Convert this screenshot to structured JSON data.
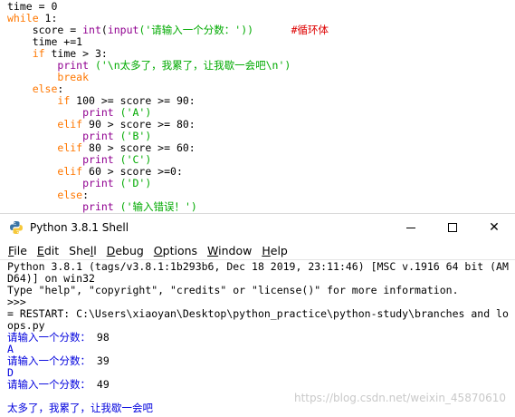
{
  "editor": {
    "lines": [
      [
        {
          "t": "time = 0",
          "c": "df"
        }
      ],
      [
        {
          "t": "while",
          "c": "kw"
        },
        {
          "t": " 1:",
          "c": "df"
        }
      ],
      [
        {
          "t": "    score = ",
          "c": "df"
        },
        {
          "t": "int",
          "c": "bi"
        },
        {
          "t": "(",
          "c": "df"
        },
        {
          "t": "input",
          "c": "bi"
        },
        {
          "t": "('请输入一个分数：'))",
          "c": "st"
        },
        {
          "t": "      ",
          "c": "df"
        },
        {
          "t": "#循环体",
          "c": "cm"
        }
      ],
      [
        {
          "t": "    time +=1",
          "c": "df"
        }
      ],
      [
        {
          "t": "    ",
          "c": "df"
        },
        {
          "t": "if",
          "c": "kw"
        },
        {
          "t": " time > 3:",
          "c": "df"
        }
      ],
      [
        {
          "t": "        ",
          "c": "df"
        },
        {
          "t": "print",
          "c": "bi"
        },
        {
          "t": " ('\\n太多了，我累了，让我歇一会吧\\n')",
          "c": "st"
        }
      ],
      [
        {
          "t": "        ",
          "c": "df"
        },
        {
          "t": "break",
          "c": "kw"
        }
      ],
      [
        {
          "t": "    ",
          "c": "df"
        },
        {
          "t": "else",
          "c": "kw"
        },
        {
          "t": ":",
          "c": "df"
        }
      ],
      [
        {
          "t": "        ",
          "c": "df"
        },
        {
          "t": "if",
          "c": "kw"
        },
        {
          "t": " 100 >= score >= 90:",
          "c": "df"
        }
      ],
      [
        {
          "t": "            ",
          "c": "df"
        },
        {
          "t": "print",
          "c": "bi"
        },
        {
          "t": " ('A')",
          "c": "st"
        }
      ],
      [
        {
          "t": "        ",
          "c": "df"
        },
        {
          "t": "elif",
          "c": "kw"
        },
        {
          "t": " 90 > score >= 80:",
          "c": "df"
        }
      ],
      [
        {
          "t": "            ",
          "c": "df"
        },
        {
          "t": "print",
          "c": "bi"
        },
        {
          "t": " ('B')",
          "c": "st"
        }
      ],
      [
        {
          "t": "        ",
          "c": "df"
        },
        {
          "t": "elif",
          "c": "kw"
        },
        {
          "t": " 80 > score >= 60:",
          "c": "df"
        }
      ],
      [
        {
          "t": "            ",
          "c": "df"
        },
        {
          "t": "print",
          "c": "bi"
        },
        {
          "t": " ('C')",
          "c": "st"
        }
      ],
      [
        {
          "t": "        ",
          "c": "df"
        },
        {
          "t": "elif",
          "c": "kw"
        },
        {
          "t": " 60 > score >=0:",
          "c": "df"
        }
      ],
      [
        {
          "t": "            ",
          "c": "df"
        },
        {
          "t": "print",
          "c": "bi"
        },
        {
          "t": " ('D')",
          "c": "st"
        }
      ],
      [
        {
          "t": "        ",
          "c": "df"
        },
        {
          "t": "else",
          "c": "kw"
        },
        {
          "t": ":",
          "c": "df"
        }
      ],
      [
        {
          "t": "            ",
          "c": "df"
        },
        {
          "t": "print",
          "c": "bi"
        },
        {
          "t": " ('输入错误！')",
          "c": "st"
        }
      ]
    ]
  },
  "window": {
    "title": "Python 3.8.1 Shell",
    "icon": "python-icon",
    "close_glyph": "✕"
  },
  "menu": {
    "file": {
      "u": "F",
      "rest": "ile"
    },
    "edit": {
      "u": "E",
      "rest": "dit"
    },
    "shell": {
      "pre": "She",
      "u": "l",
      "rest": "l"
    },
    "debug": {
      "u": "D",
      "rest": "ebug"
    },
    "options": {
      "u": "O",
      "rest": "ptions"
    },
    "window": {
      "u": "W",
      "rest": "indow"
    },
    "help": {
      "u": "H",
      "rest": "elp"
    }
  },
  "shell": {
    "lines": [
      {
        "t": "Python 3.8.1 (tags/v3.8.1:1b293b6, Dec 18 2019, 23:11:46) [MSC v.1916 64 bit (AM",
        "c": "blk"
      },
      {
        "t": "D64)] on win32",
        "c": "blk"
      },
      {
        "t": "Type \"help\", \"copyright\", \"credits\" or \"license()\" for more information.",
        "c": "blk"
      },
      {
        "t": ">>>",
        "c": "blk"
      },
      {
        "t": "= RESTART: C:\\Users\\xiaoyan\\Desktop\\python_practice\\python-study\\branches and lo",
        "c": "blk"
      },
      {
        "t": "ops.py",
        "c": "blk"
      },
      {
        "t": "请输入一个分数：",
        "c": "blu",
        "input": "98"
      },
      {
        "t": "A",
        "c": "blu"
      },
      {
        "t": "请输入一个分数：",
        "c": "blu",
        "input": "39"
      },
      {
        "t": "D",
        "c": "blu"
      },
      {
        "t": "请输入一个分数：",
        "c": "blu",
        "input": "49"
      },
      {
        "t": "",
        "c": "gap"
      },
      {
        "t": "太多了，我累了，让我歇一会吧",
        "c": "blu"
      }
    ]
  },
  "watermark": "https://blog.csdn.net/weixin_45870610",
  "colors": {
    "keyword": "#ff7700",
    "builtin": "#900090",
    "string": "#00aa00",
    "comment": "#dd0000",
    "shell_output": "#0000dd"
  }
}
